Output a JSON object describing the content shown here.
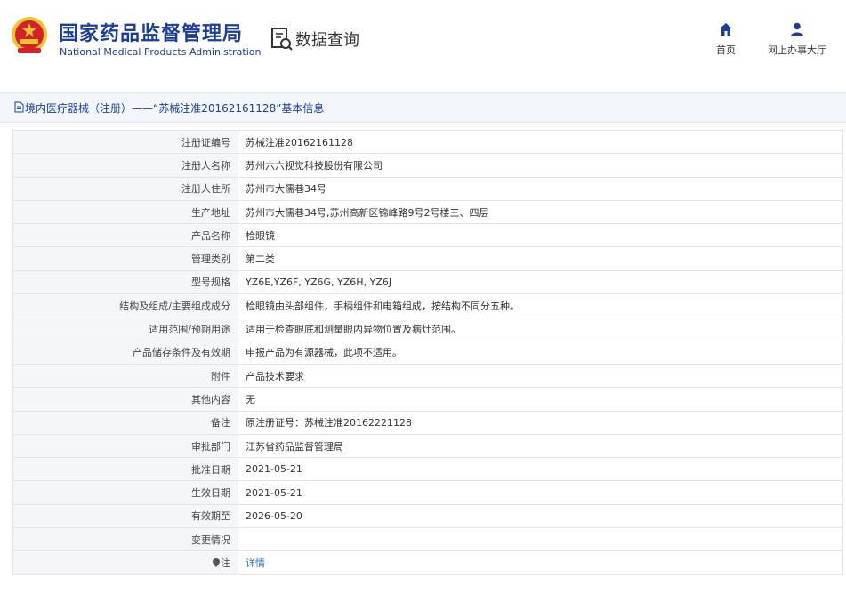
{
  "header": {
    "org_name_cn": "国家药品监督管理局",
    "org_name_en": "National Medical Products Administration",
    "search_title": "数据查询",
    "nav": [
      {
        "label": "首页",
        "icon": "home-icon"
      },
      {
        "label": "网上办事大厅",
        "icon": "user-icon"
      }
    ]
  },
  "page": {
    "title": "境内医疗器械（注册）——“苏械注准20162161128”基本信息"
  },
  "rows": [
    {
      "label": "注册证编号",
      "value": "苏械注准20162161128"
    },
    {
      "label": "注册人名称",
      "value": "苏州六六视觉科技股份有限公司"
    },
    {
      "label": "注册人住所",
      "value": "苏州市大儒巷34号"
    },
    {
      "label": "生产地址",
      "value": "苏州市大儒巷34号,苏州高新区锦峰路9号2号楼三、四层"
    },
    {
      "label": "产品名称",
      "value": "检眼镜"
    },
    {
      "label": "管理类别",
      "value": "第二类"
    },
    {
      "label": "型号规格",
      "value": "YZ6E,YZ6F, YZ6G, YZ6H, YZ6J"
    },
    {
      "label": "结构及组成/主要组成成分",
      "value": "检眼镜由头部组件，手柄组件和电箱组成，按结构不同分五种。"
    },
    {
      "label": "适用范围/预期用途",
      "value": "适用于检查眼底和测量眼内异物位置及病灶范围。"
    },
    {
      "label": "产品储存条件及有效期",
      "value": "申报产品为有源器械，此项不适用。"
    },
    {
      "label": "附件",
      "value": "产品技术要求"
    },
    {
      "label": "其他内容",
      "value": "无"
    },
    {
      "label": "备注",
      "value": "原注册证号：苏械注准20162221128"
    },
    {
      "label": "审批部门",
      "value": "江苏省药品监督管理局"
    },
    {
      "label": "批准日期",
      "value": "2021-05-21"
    },
    {
      "label": "生效日期",
      "value": "2021-05-21"
    },
    {
      "label": "有效期至",
      "value": "2026-05-20"
    },
    {
      "label": "变更情况",
      "value": ""
    },
    {
      "label": "注",
      "value": "详情",
      "label_icon": "pin-icon",
      "value_is_link": true
    }
  ],
  "colors": {
    "brand_blue": "#1c3f95",
    "link_blue": "#2f6fc0",
    "emblem_red": "#d2232a",
    "emblem_gold": "#f3c131"
  }
}
